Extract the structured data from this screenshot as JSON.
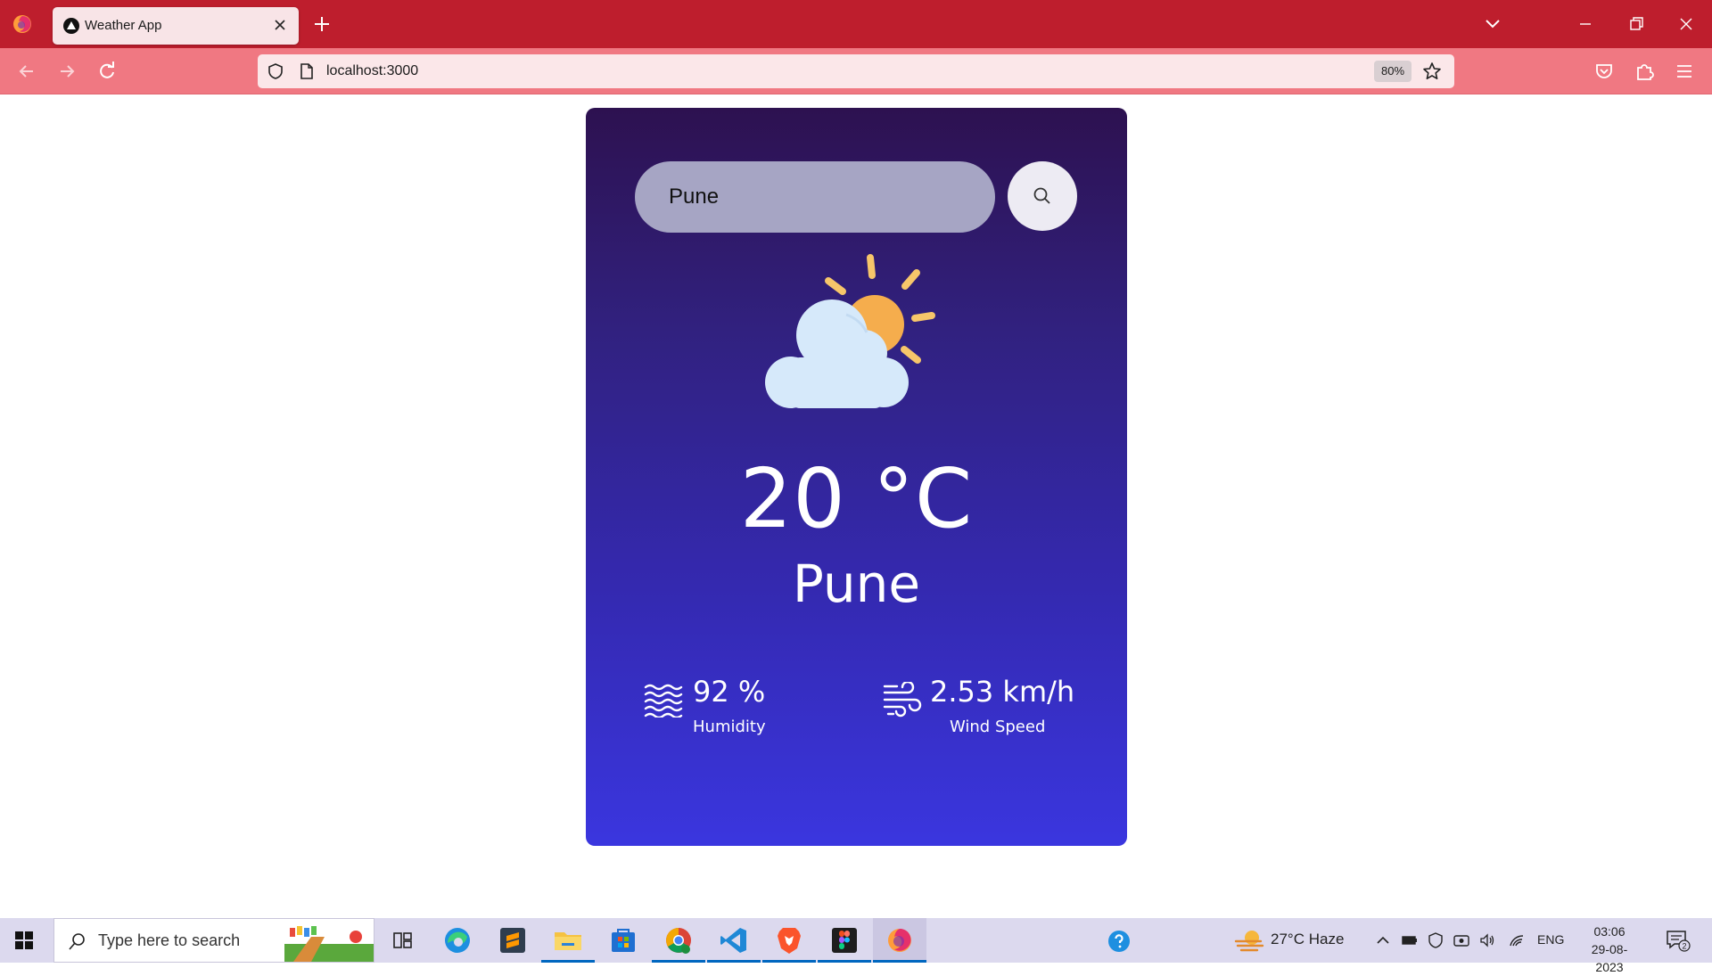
{
  "browser": {
    "tab_title": "Weather App",
    "url": "localhost:3000",
    "zoom": "80%"
  },
  "app": {
    "search": {
      "value": "Pune",
      "placeholder": ""
    },
    "condition_icon": "sun-behind-cloud-icon",
    "temperature": "20 °C",
    "city": "Pune",
    "humidity": {
      "value": "92 %",
      "label": "Humidity",
      "icon": "humidity-waves-icon"
    },
    "wind": {
      "value": "2.53 km/h",
      "label": "Wind Speed",
      "icon": "wind-icon"
    },
    "colors": {
      "card_top": "#2d1150",
      "card_bottom": "#3a36df",
      "search_bg": "#a6a5c4",
      "search_button_bg": "#edebf3",
      "sun": "#f5ad4d",
      "cloud": "#d6e9fa"
    }
  },
  "taskbar": {
    "search_placeholder": "Type here to search",
    "apps": [
      "task-view-icon",
      "edge-icon",
      "sublime-text-icon",
      "file-explorer-icon",
      "store-icon",
      "chrome-icon",
      "vscode-icon",
      "brave-icon",
      "figma-icon",
      "firefox-icon"
    ],
    "weather": "27°C  Haze",
    "language": "ENG",
    "time": "03:06",
    "date": "29-08-2023",
    "notifications": "2"
  }
}
